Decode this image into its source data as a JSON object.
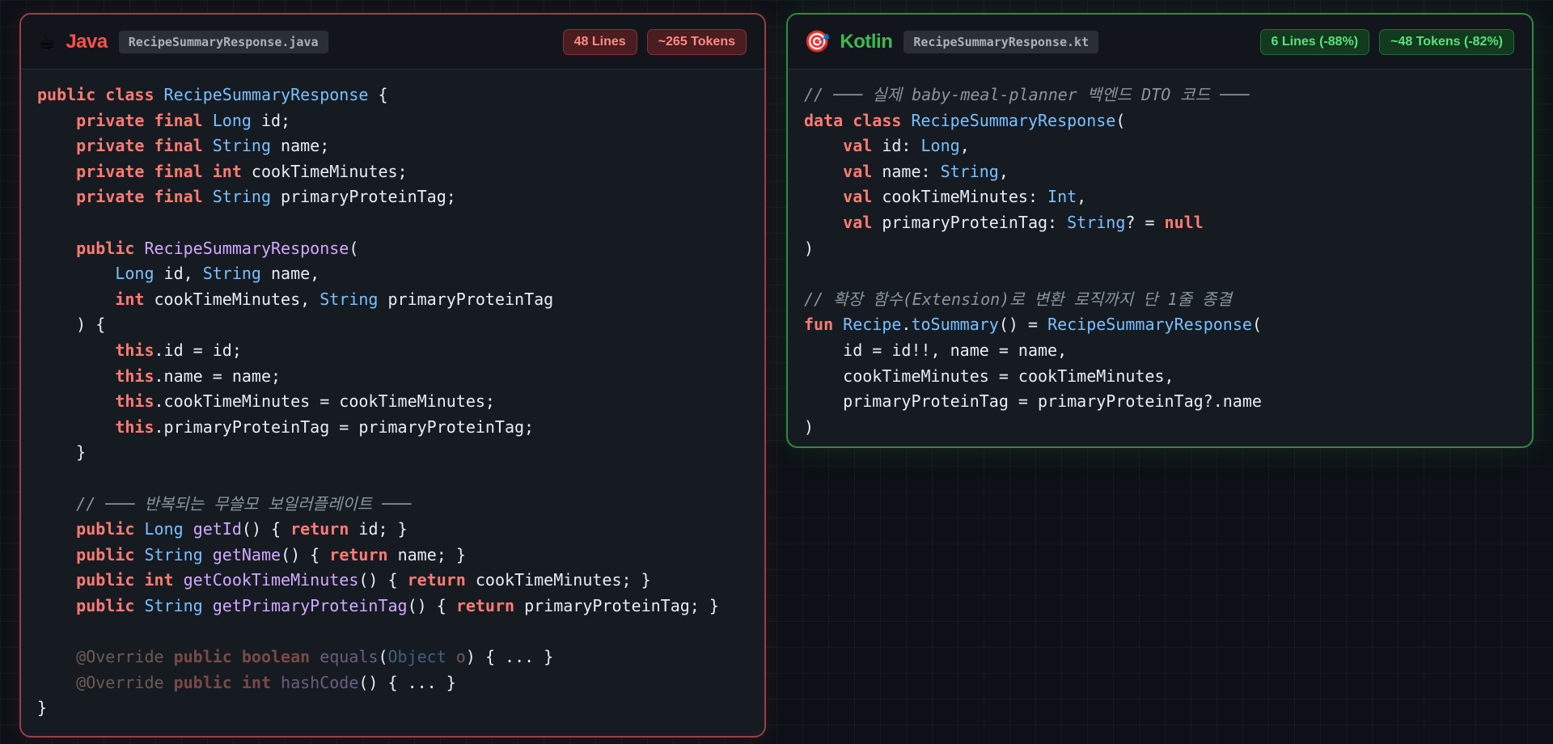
{
  "java": {
    "icon": "☕",
    "language": "Java",
    "filename": "RecipeSummaryResponse.java",
    "lines_badge": "48 Lines",
    "tokens_badge": "~265 Tokens",
    "code": [
      [
        [
          "k",
          "public class "
        ],
        [
          "t",
          "RecipeSummaryResponse"
        ],
        [
          "p",
          " {"
        ]
      ],
      [
        [
          "p",
          "    "
        ],
        [
          "k",
          "private final "
        ],
        [
          "t",
          "Long"
        ],
        [
          "p",
          " id;"
        ]
      ],
      [
        [
          "p",
          "    "
        ],
        [
          "k",
          "private final "
        ],
        [
          "t",
          "String"
        ],
        [
          "p",
          " name;"
        ]
      ],
      [
        [
          "p",
          "    "
        ],
        [
          "k",
          "private final int"
        ],
        [
          "p",
          " cookTimeMinutes;"
        ]
      ],
      [
        [
          "p",
          "    "
        ],
        [
          "k",
          "private final "
        ],
        [
          "t",
          "String"
        ],
        [
          "p",
          " primaryProteinTag;"
        ]
      ],
      [],
      [
        [
          "p",
          "    "
        ],
        [
          "k",
          "public "
        ],
        [
          "f",
          "RecipeSummaryResponse"
        ],
        [
          "p",
          "("
        ]
      ],
      [
        [
          "p",
          "        "
        ],
        [
          "t",
          "Long"
        ],
        [
          "p",
          " id, "
        ],
        [
          "t",
          "String"
        ],
        [
          "p",
          " name,"
        ]
      ],
      [
        [
          "p",
          "        "
        ],
        [
          "k",
          "int"
        ],
        [
          "p",
          " cookTimeMinutes, "
        ],
        [
          "t",
          "String"
        ],
        [
          "p",
          " primaryProteinTag"
        ]
      ],
      [
        [
          "p",
          "    ) {"
        ]
      ],
      [
        [
          "p",
          "        "
        ],
        [
          "k",
          "this"
        ],
        [
          "p",
          ".id = id;"
        ]
      ],
      [
        [
          "p",
          "        "
        ],
        [
          "k",
          "this"
        ],
        [
          "p",
          ".name = name;"
        ]
      ],
      [
        [
          "p",
          "        "
        ],
        [
          "k",
          "this"
        ],
        [
          "p",
          ".cookTimeMinutes = cookTimeMinutes;"
        ]
      ],
      [
        [
          "p",
          "        "
        ],
        [
          "k",
          "this"
        ],
        [
          "p",
          ".primaryProteinTag = primaryProteinTag;"
        ]
      ],
      [
        [
          "p",
          "    }"
        ]
      ],
      [],
      [
        [
          "p",
          "    "
        ],
        [
          "c",
          "// ─── 반복되는 무쓸모 보일러플레이트 ───"
        ]
      ],
      [
        [
          "p",
          "    "
        ],
        [
          "k",
          "public "
        ],
        [
          "t",
          "Long "
        ],
        [
          "f",
          "getId"
        ],
        [
          "p",
          "() { "
        ],
        [
          "k",
          "return"
        ],
        [
          "p",
          " id; }"
        ]
      ],
      [
        [
          "p",
          "    "
        ],
        [
          "k",
          "public "
        ],
        [
          "t",
          "String "
        ],
        [
          "f",
          "getName"
        ],
        [
          "p",
          "() { "
        ],
        [
          "k",
          "return"
        ],
        [
          "p",
          " name; }"
        ]
      ],
      [
        [
          "p",
          "    "
        ],
        [
          "k",
          "public int "
        ],
        [
          "f",
          "getCookTimeMinutes"
        ],
        [
          "p",
          "() { "
        ],
        [
          "k",
          "return"
        ],
        [
          "p",
          " cookTimeMinutes; }"
        ]
      ],
      [
        [
          "p",
          "    "
        ],
        [
          "k",
          "public "
        ],
        [
          "t",
          "String "
        ],
        [
          "f",
          "getPrimaryProteinTag"
        ],
        [
          "p",
          "() { "
        ],
        [
          "k",
          "return"
        ],
        [
          "p",
          " primaryProteinTag; }"
        ]
      ],
      [],
      [
        [
          "p",
          "    "
        ],
        [
          "dim",
          "@Override "
        ],
        [
          "dimk",
          "public boolean "
        ],
        [
          "dimf",
          "equals"
        ],
        [
          "p",
          "("
        ],
        [
          "dimt",
          "Object"
        ],
        [
          "dim",
          " o"
        ],
        [
          "p",
          ") { ... }"
        ]
      ],
      [
        [
          "p",
          "    "
        ],
        [
          "dim",
          "@Override "
        ],
        [
          "dimk",
          "public int "
        ],
        [
          "dimf",
          "hashCode"
        ],
        [
          "p",
          "() { ... }"
        ]
      ],
      [
        [
          "p",
          "}"
        ]
      ]
    ]
  },
  "kotlin": {
    "icon": "🎯",
    "language": "Kotlin",
    "filename": "RecipeSummaryResponse.kt",
    "lines_badge": "6 Lines (-88%)",
    "tokens_badge": "~48 Tokens (-82%)",
    "code": [
      [
        [
          "c",
          "// ─── 실제 baby-meal-planner 백엔드 DTO 코드 ───"
        ]
      ],
      [
        [
          "k",
          "data class "
        ],
        [
          "t",
          "RecipeSummaryResponse"
        ],
        [
          "p",
          "("
        ]
      ],
      [
        [
          "p",
          "    "
        ],
        [
          "k",
          "val"
        ],
        [
          "p",
          " id: "
        ],
        [
          "t",
          "Long"
        ],
        [
          "p",
          ","
        ]
      ],
      [
        [
          "p",
          "    "
        ],
        [
          "k",
          "val"
        ],
        [
          "p",
          " name: "
        ],
        [
          "t",
          "String"
        ],
        [
          "p",
          ","
        ]
      ],
      [
        [
          "p",
          "    "
        ],
        [
          "k",
          "val"
        ],
        [
          "p",
          " cookTimeMinutes: "
        ],
        [
          "t",
          "Int"
        ],
        [
          "p",
          ","
        ]
      ],
      [
        [
          "p",
          "    "
        ],
        [
          "k",
          "val"
        ],
        [
          "p",
          " primaryProteinTag: "
        ],
        [
          "t",
          "String"
        ],
        [
          "p",
          "? = "
        ],
        [
          "k",
          "null"
        ]
      ],
      [
        [
          "p",
          ")"
        ]
      ],
      [],
      [
        [
          "c",
          "// 확장 함수(Extension)로 변환 로직까지 단 1줄 종결"
        ]
      ],
      [
        [
          "k",
          "fun "
        ],
        [
          "t",
          "Recipe"
        ],
        [
          "p",
          "."
        ],
        [
          "t",
          "toSummary"
        ],
        [
          "p",
          "() = "
        ],
        [
          "t",
          "RecipeSummaryResponse"
        ],
        [
          "p",
          "("
        ]
      ],
      [
        [
          "p",
          "    id = id!!, name = name,"
        ]
      ],
      [
        [
          "p",
          "    cookTimeMinutes = cookTimeMinutes,"
        ]
      ],
      [
        [
          "p",
          "    primaryProteinTag = primaryProteinTag?.name"
        ]
      ],
      [
        [
          "p",
          ")"
        ]
      ]
    ]
  }
}
